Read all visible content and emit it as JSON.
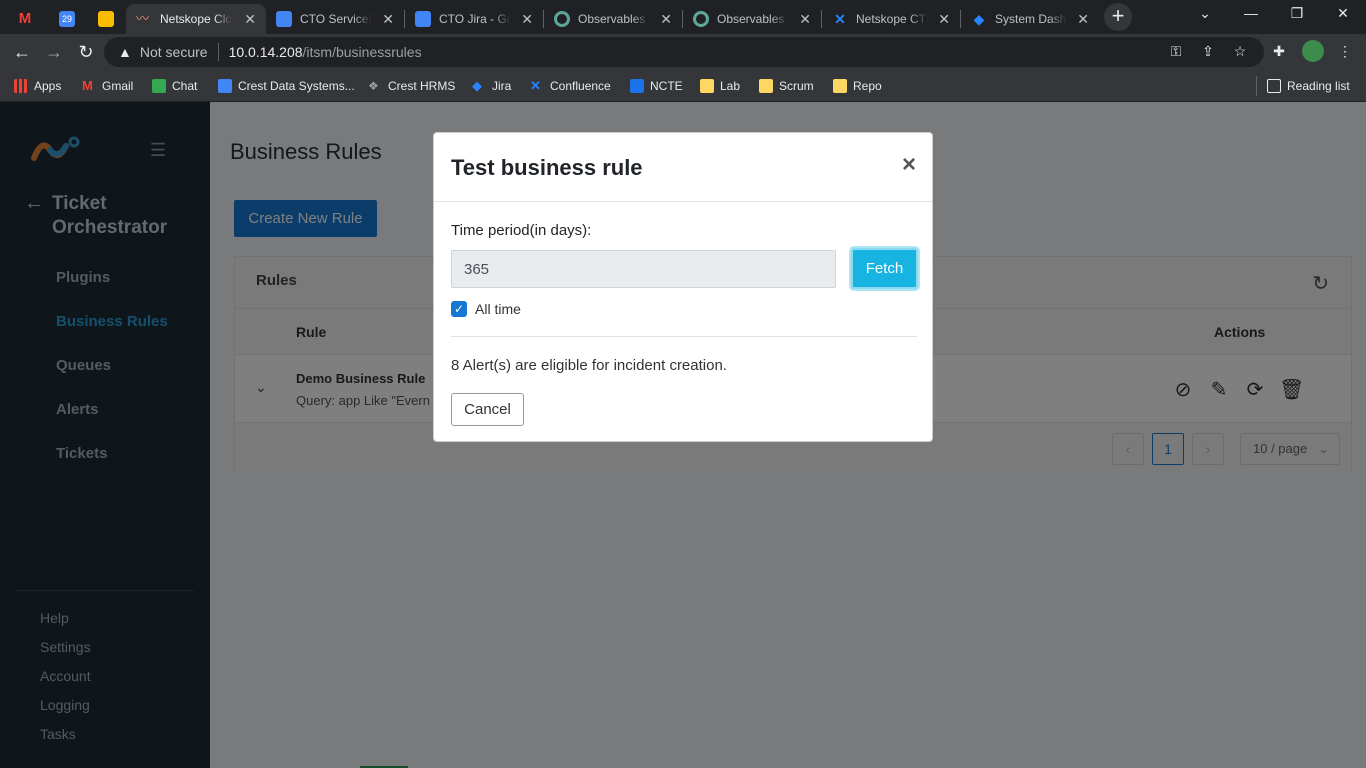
{
  "browser": {
    "tabs": [
      {
        "title": "Netskope Cloud Exchange",
        "color": "#f28b82",
        "icon": "netskope-icon"
      },
      {
        "title": "CTO ServiceNow",
        "color": "#4285f4",
        "icon": "docs-icon"
      },
      {
        "title": "CTO Jira - Google Docs",
        "color": "#4285f4",
        "icon": "docs-icon"
      },
      {
        "title": "Observables",
        "color": "#5fa59a",
        "icon": "observables-icon"
      },
      {
        "title": "Observables",
        "color": "#5fa59a",
        "icon": "observables-icon"
      },
      {
        "title": "Netskope CTE",
        "color": "#2684ff",
        "icon": "confluence-icon"
      },
      {
        "title": "System Dashboard",
        "color": "#2684ff",
        "icon": "jira-icon"
      }
    ],
    "pinned": [
      {
        "label": "M",
        "color": "#ea4335",
        "icon": "gmail-icon"
      },
      {
        "label": "29",
        "color": "#4285f4",
        "icon": "calendar-icon"
      },
      {
        "label": "",
        "color": "#fbbc04",
        "icon": "keep-icon"
      }
    ],
    "address": {
      "security_label": "Not secure",
      "host": "10.0.14.208",
      "path": "/itsm/businessrules"
    },
    "bookmarks": [
      {
        "label": "Apps",
        "color": "#ea4335"
      },
      {
        "label": "Gmail",
        "color": "#ea4335"
      },
      {
        "label": "Chat",
        "color": "#34a853"
      },
      {
        "label": "Crest Data Systems...",
        "color": "#4285f4"
      },
      {
        "label": "Crest HRMS",
        "color": "#9aa0a6"
      },
      {
        "label": "Jira",
        "color": "#2684ff"
      },
      {
        "label": "Confluence",
        "color": "#2684ff"
      },
      {
        "label": "NCTE",
        "color": "#1a73e8"
      },
      {
        "label": "Lab",
        "color": "#fdd663"
      },
      {
        "label": "Scrum",
        "color": "#fdd663"
      },
      {
        "label": "Repo",
        "color": "#fdd663"
      }
    ],
    "reading_list": "Reading list"
  },
  "sidebar": {
    "product_title": "Ticket Orchestrator",
    "items": [
      {
        "label": "Plugins",
        "active": false
      },
      {
        "label": "Business Rules",
        "active": true
      },
      {
        "label": "Queues",
        "active": false
      },
      {
        "label": "Alerts",
        "active": false
      },
      {
        "label": "Tickets",
        "active": false
      }
    ],
    "footer": [
      "Help",
      "Settings",
      "Account",
      "Logging",
      "Tasks"
    ]
  },
  "main": {
    "page_title": "Business Rules",
    "create_button": "Create New Rule",
    "card_title": "Rules",
    "columns": {
      "rule": "Rule",
      "actions": "Actions"
    },
    "rows": [
      {
        "name": "Demo Business Rule",
        "query": "Query: app Like \"Evern"
      }
    ],
    "pagination": {
      "current": "1",
      "page_size": "10 / page"
    }
  },
  "modal": {
    "title": "Test business rule",
    "field_label": "Time period(in days):",
    "period_value": "365",
    "fetch_button": "Fetch",
    "all_time_label": "All time",
    "all_time_checked": true,
    "result": "8 Alert(s) are eligible for incident creation.",
    "cancel_button": "Cancel"
  },
  "colors": {
    "sidebar_bg": "#1d2c37",
    "accent": "#1678d4",
    "active_nav": "#2b9fd9",
    "fetch": "#17b4e2"
  }
}
